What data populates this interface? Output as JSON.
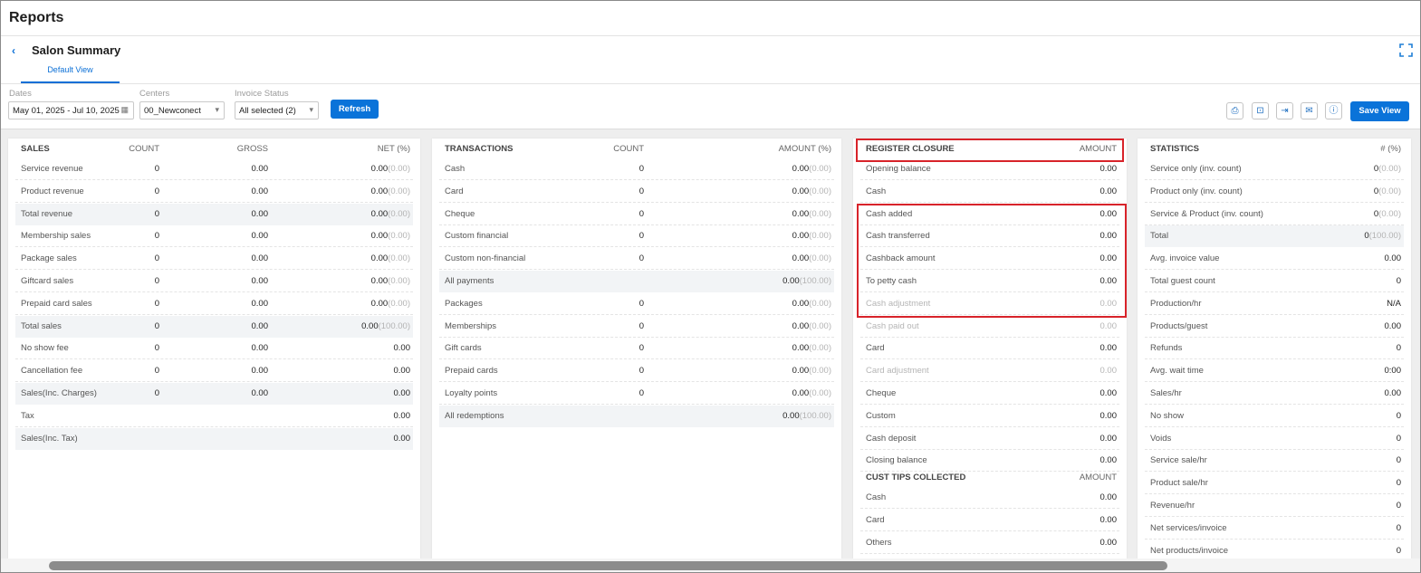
{
  "app": {
    "title": "Reports"
  },
  "report": {
    "back_icon": "chevron-left-icon",
    "title": "Salon Summary",
    "expand_icon": "expand-icon",
    "tab": "Default View"
  },
  "filters": {
    "dates_label": "Dates",
    "dates_value": "May 01, 2025 - Jul 10, 2025",
    "centers_label": "Centers",
    "centers_value": "00_Newconect",
    "invoice_label": "Invoice Status",
    "invoice_value": "All selected (2)",
    "refresh": "Refresh",
    "save_view": "Save View",
    "icons": [
      "print-icon",
      "preview-icon",
      "export-icon",
      "email-icon",
      "info-icon"
    ]
  },
  "sales": {
    "header": {
      "label": "SALES",
      "count": "COUNT",
      "gross": "GROSS",
      "net": "NET (%)"
    },
    "rows": [
      {
        "label": "Service revenue",
        "count": "0",
        "gross": "0.00",
        "net": "0.00",
        "pct": "(0.00)"
      },
      {
        "label": "Product revenue",
        "count": "0",
        "gross": "0.00",
        "net": "0.00",
        "pct": "(0.00)"
      },
      {
        "label": "Total revenue",
        "count": "0",
        "gross": "0.00",
        "net": "0.00",
        "pct": "(0.00)"
      },
      {
        "label": "Membership sales",
        "count": "0",
        "gross": "0.00",
        "net": "0.00",
        "pct": "(0.00)"
      },
      {
        "label": "Package sales",
        "count": "0",
        "gross": "0.00",
        "net": "0.00",
        "pct": "(0.00)"
      },
      {
        "label": "Giftcard sales",
        "count": "0",
        "gross": "0.00",
        "net": "0.00",
        "pct": "(0.00)"
      },
      {
        "label": "Prepaid card sales",
        "count": "0",
        "gross": "0.00",
        "net": "0.00",
        "pct": "(0.00)"
      },
      {
        "label": "Total sales",
        "count": "0",
        "gross": "0.00",
        "net": "0.00",
        "pct": "(100.00)"
      },
      {
        "label": "No show fee",
        "count": "0",
        "gross": "0.00",
        "net": "0.00",
        "pct": ""
      },
      {
        "label": "Cancellation fee",
        "count": "0",
        "gross": "0.00",
        "net": "0.00",
        "pct": ""
      },
      {
        "label": "Sales(Inc. Charges)",
        "count": "0",
        "gross": "0.00",
        "net": "0.00",
        "pct": ""
      },
      {
        "label": "Tax",
        "count": "",
        "gross": "",
        "net": "0.00",
        "pct": ""
      },
      {
        "label": "Sales(Inc. Tax)",
        "count": "",
        "gross": "",
        "net": "0.00",
        "pct": ""
      }
    ]
  },
  "transactions": {
    "header": {
      "label": "TRANSACTIONS",
      "count": "COUNT",
      "amount": "AMOUNT (%)"
    },
    "rows": [
      {
        "label": "Cash",
        "count": "0",
        "amount": "0.00",
        "pct": "(0.00)"
      },
      {
        "label": "Card",
        "count": "0",
        "amount": "0.00",
        "pct": "(0.00)"
      },
      {
        "label": "Cheque",
        "count": "0",
        "amount": "0.00",
        "pct": "(0.00)"
      },
      {
        "label": "Custom financial",
        "count": "0",
        "amount": "0.00",
        "pct": "(0.00)"
      },
      {
        "label": "Custom non-financial",
        "count": "0",
        "amount": "0.00",
        "pct": "(0.00)"
      },
      {
        "label": "All payments",
        "count": "",
        "amount": "0.00",
        "pct": "(100.00)"
      },
      {
        "label": "Packages",
        "count": "0",
        "amount": "0.00",
        "pct": "(0.00)"
      },
      {
        "label": "Memberships",
        "count": "0",
        "amount": "0.00",
        "pct": "(0.00)"
      },
      {
        "label": "Gift cards",
        "count": "0",
        "amount": "0.00",
        "pct": "(0.00)"
      },
      {
        "label": "Prepaid cards",
        "count": "0",
        "amount": "0.00",
        "pct": "(0.00)"
      },
      {
        "label": "Loyalty points",
        "count": "0",
        "amount": "0.00",
        "pct": "(0.00)"
      },
      {
        "label": "All redemptions",
        "count": "",
        "amount": "0.00",
        "pct": "(100.00)"
      }
    ]
  },
  "register": {
    "header": {
      "label": "REGISTER CLOSURE",
      "amount": "AMOUNT"
    },
    "rows": [
      {
        "label": "Opening balance",
        "amount": "0.00"
      },
      {
        "label": "Cash",
        "amount": "0.00"
      },
      {
        "label": "Cash added",
        "amount": "0.00"
      },
      {
        "label": "Cash transferred",
        "amount": "0.00"
      },
      {
        "label": "Cashback amount",
        "amount": "0.00"
      },
      {
        "label": "To petty cash",
        "amount": "0.00"
      },
      {
        "label": "Cash adjustment",
        "amount": "0.00"
      },
      {
        "label": "Cash paid out",
        "amount": "0.00"
      },
      {
        "label": "Card",
        "amount": "0.00"
      },
      {
        "label": "Card adjustment",
        "amount": "0.00"
      },
      {
        "label": "Cheque",
        "amount": "0.00"
      },
      {
        "label": "Custom",
        "amount": "0.00"
      },
      {
        "label": "Cash deposit",
        "amount": "0.00"
      },
      {
        "label": "Closing balance",
        "amount": "0.00"
      }
    ],
    "tips_header": {
      "label": "CUST TIPS COLLECTED",
      "amount": "AMOUNT"
    },
    "tips_rows": [
      {
        "label": "Cash",
        "amount": "0.00"
      },
      {
        "label": "Card",
        "amount": "0.00"
      },
      {
        "label": "Others",
        "amount": "0.00"
      }
    ]
  },
  "statistics": {
    "header": {
      "label": "STATISTICS",
      "amount": "# (%)"
    },
    "rows": [
      {
        "label": "Service only (inv. count)",
        "value": "0",
        "pct": "(0.00)"
      },
      {
        "label": "Product only (inv. count)",
        "value": "0",
        "pct": "(0.00)"
      },
      {
        "label": "Service & Product (inv. count)",
        "value": "0",
        "pct": "(0.00)"
      },
      {
        "label": "Total",
        "value": "0",
        "pct": "(100.00)"
      },
      {
        "label": "Avg. invoice value",
        "value": "0.00",
        "pct": ""
      },
      {
        "label": "Total guest count",
        "value": "0",
        "pct": ""
      },
      {
        "label": "Production/hr",
        "value": "N/A",
        "pct": ""
      },
      {
        "label": "Products/guest",
        "value": "0.00",
        "pct": ""
      },
      {
        "label": "Refunds",
        "value": "0",
        "pct": ""
      },
      {
        "label": "Avg. wait time",
        "value": "0:00",
        "pct": ""
      },
      {
        "label": "Sales/hr",
        "value": "0.00",
        "pct": ""
      },
      {
        "label": "No show",
        "value": "0",
        "pct": ""
      },
      {
        "label": "Voids",
        "value": "0",
        "pct": ""
      },
      {
        "label": "Service sale/hr",
        "value": "0",
        "pct": ""
      },
      {
        "label": "Product sale/hr",
        "value": "0",
        "pct": ""
      },
      {
        "label": "Revenue/hr",
        "value": "0",
        "pct": ""
      },
      {
        "label": "Net services/invoice",
        "value": "0",
        "pct": ""
      },
      {
        "label": "Net products/invoice",
        "value": "0",
        "pct": ""
      }
    ]
  }
}
